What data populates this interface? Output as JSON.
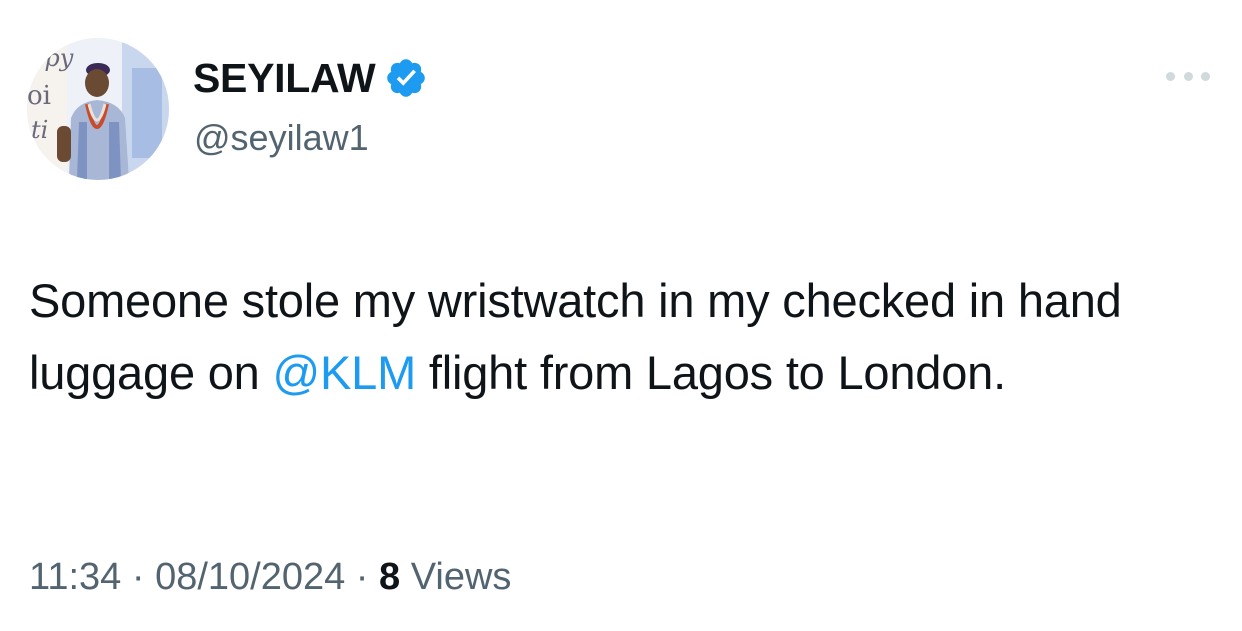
{
  "author": {
    "display_name": "SEYILAW",
    "handle": "@seyilaw1",
    "verified": true,
    "avatar_icon": "profile-photo",
    "avatar_text": "ppy"
  },
  "menu_icon": "more-horizontal-icon",
  "tweet": {
    "text_part1": "Someone stole my wristwatch in my checked in hand luggage on ",
    "mention": "@KLM",
    "text_part2": " flight from Lagos to London."
  },
  "meta": {
    "time": "11:34",
    "separator1": " · ",
    "date": "08/10/2024",
    "separator2": " · ",
    "views_count": "8",
    "views_label": " Views"
  },
  "colors": {
    "accent": "#1d9bf0",
    "text_primary": "#0f1419",
    "text_secondary": "#536471"
  }
}
